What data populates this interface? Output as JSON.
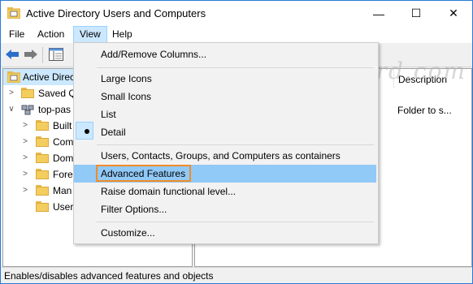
{
  "window": {
    "title": "Active Directory Users and Computers",
    "controls": {
      "minimize": "—",
      "maximize": "☐",
      "close": "✕"
    }
  },
  "menubar": {
    "items": [
      "File",
      "Action",
      "View",
      "Help"
    ],
    "active": "View"
  },
  "tree": {
    "items": [
      {
        "label": "Active Directo",
        "icon": "ad-console-icon",
        "selected": true
      },
      {
        "label": "Saved Q",
        "icon": "folder-icon",
        "chevron": ">"
      },
      {
        "label": "top-pas",
        "icon": "domain-icon",
        "chevron": "∨"
      },
      {
        "label": "Built",
        "icon": "folder-icon",
        "chevron": ">"
      },
      {
        "label": "Com",
        "icon": "folder-icon",
        "chevron": ">"
      },
      {
        "label": "Dom",
        "icon": "ou-folder-icon",
        "chevron": ">"
      },
      {
        "label": "Fore",
        "icon": "folder-icon",
        "chevron": ">"
      },
      {
        "label": "Man",
        "icon": "folder-icon",
        "chevron": ">"
      },
      {
        "label": "User",
        "icon": "folder-icon"
      }
    ]
  },
  "details": {
    "column_header": "Description",
    "row_text": "Folder to s..."
  },
  "watermark": "top-password.com",
  "view_menu": {
    "items": [
      "Add/Remove Columns...",
      "Large Icons",
      "Small Icons",
      "List",
      "Detail",
      "Users, Contacts, Groups, and Computers as containers",
      "Advanced Features",
      "Raise domain functional level...",
      "Filter Options...",
      "Customize..."
    ],
    "checked": "Detail",
    "hovered": "Advanced Features"
  },
  "status": {
    "text": "Enables/disables advanced features and objects"
  },
  "colors": {
    "accent": "#2b79d7",
    "hover": "#91c9f7",
    "highlight_border": "#f28c28"
  }
}
